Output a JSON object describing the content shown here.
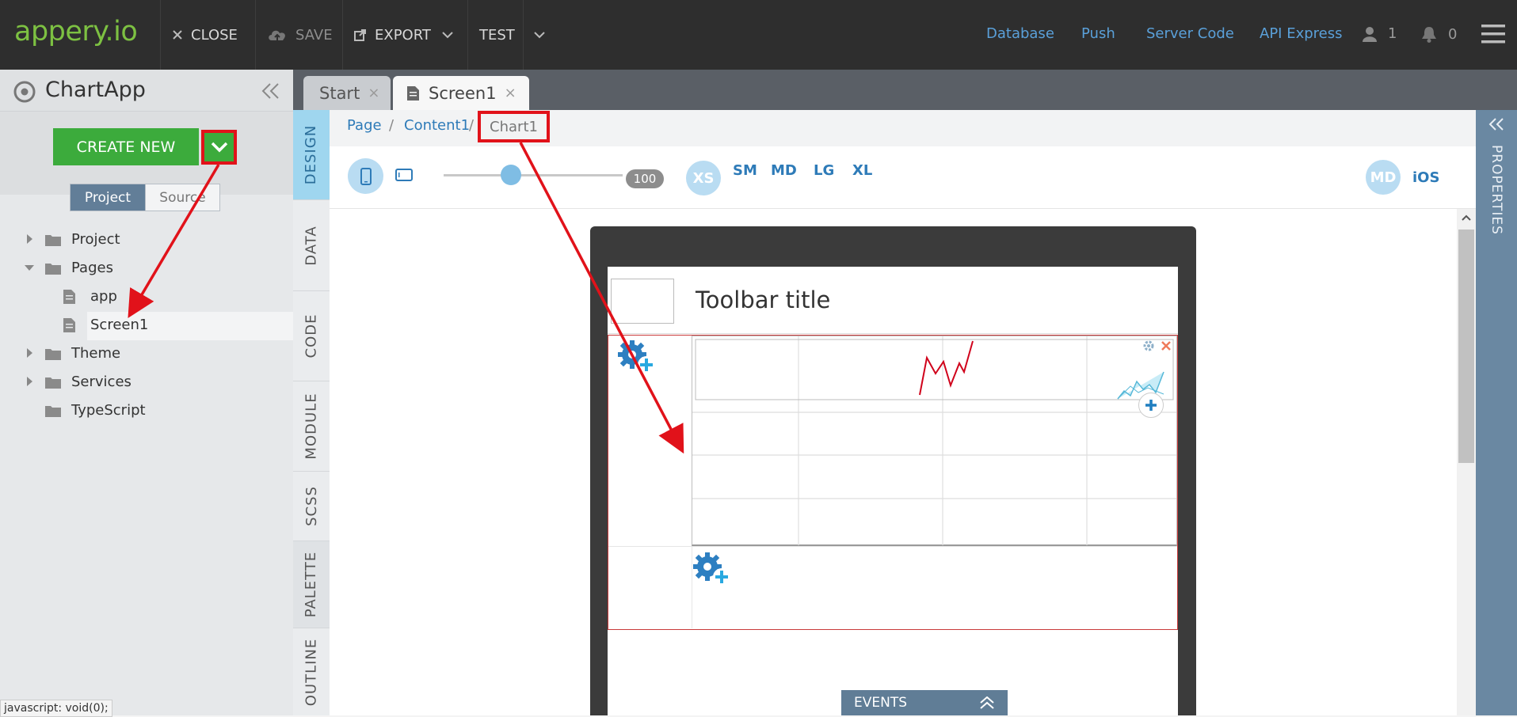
{
  "header": {
    "logo": {
      "word": "appery",
      "dot": ".",
      "suffix": "io"
    },
    "buttons": {
      "close": "CLOSE",
      "save": "SAVE",
      "export": "EXPORT",
      "test": "TEST"
    },
    "links": {
      "database": "Database",
      "push": "Push",
      "server_code": "Server Code",
      "api_express": "API Express"
    },
    "user_count": "1",
    "notification_count": "0"
  },
  "sidebar": {
    "app_name": "ChartApp",
    "create_new": "CREATE NEW",
    "segments": {
      "project": "Project",
      "source": "Source"
    },
    "tree": [
      {
        "label": "Project"
      },
      {
        "label": "Pages"
      },
      {
        "label": "app"
      },
      {
        "label": "Screen1"
      },
      {
        "label": "Theme"
      },
      {
        "label": "Services"
      },
      {
        "label": "TypeScript"
      }
    ]
  },
  "tabs": [
    {
      "label": "Start",
      "close": "×"
    },
    {
      "label": "Screen1",
      "close": "×"
    }
  ],
  "side_tabs": [
    "DESIGN",
    "DATA",
    "CODE",
    "MODULE",
    "SCSS",
    "PALETTE",
    "OUTLINE"
  ],
  "breadcrumb": {
    "page": "Page",
    "sep1": "/",
    "content": "Content1",
    "sep2": "/",
    "chart": "Chart1"
  },
  "devices": {
    "zoom": "100",
    "sizes": [
      "XS",
      "SM",
      "MD",
      "LG",
      "XL"
    ],
    "platform_badge": "MD",
    "platform": "iOS"
  },
  "properties_label": "PROPERTIES",
  "design": {
    "toolbar_title": "Toolbar title",
    "events_label": "EVENTS"
  },
  "status_tip": "javascript: void(0);",
  "colors": {
    "topbar": "#2e2e2e",
    "accent_blue": "#2e7bb8",
    "create_green": "#3cab3c",
    "highlight_red": "#e1121a",
    "chart_line": "#d0021b"
  }
}
